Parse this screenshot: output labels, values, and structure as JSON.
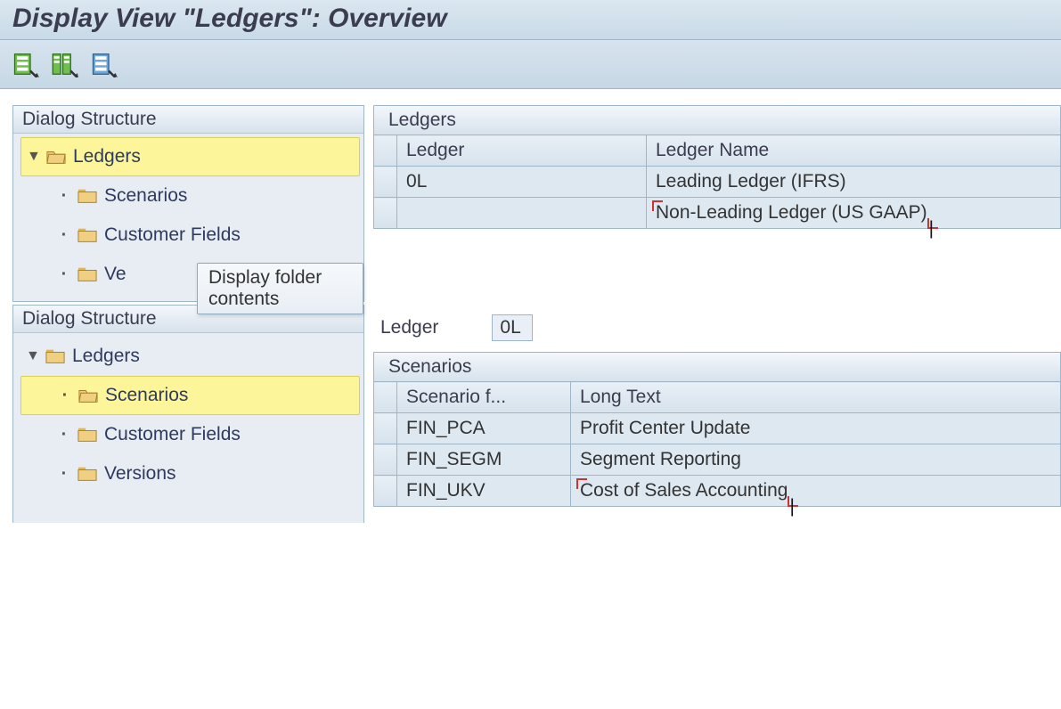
{
  "title": "Display View \"Ledgers\": Overview",
  "toolbar": {
    "icons": [
      "table-green-icon",
      "table-double-green-icon",
      "table-blue-icon"
    ]
  },
  "tree_header": "Dialog Structure",
  "tree1": {
    "root": "Ledgers",
    "children": [
      "Scenarios",
      "Customer Fields",
      "Ve"
    ],
    "selected": "Ledgers"
  },
  "tree2": {
    "root": "Ledgers",
    "children": [
      "Scenarios",
      "Customer Fields",
      "Versions"
    ],
    "selected": "Scenarios"
  },
  "tooltip": "Display folder contents",
  "ledgers_table": {
    "title": "Ledgers",
    "columns": [
      "Ledger",
      "Ledger Name"
    ],
    "rows": [
      {
        "ledger": "0L",
        "name": "Leading Ledger (IFRS)"
      },
      {
        "ledger": "",
        "name": "Non-Leading Ledger (US GAAP)"
      }
    ]
  },
  "ledger_field": {
    "label": "Ledger",
    "value": "0L"
  },
  "scenarios_table": {
    "title": "Scenarios",
    "columns": [
      "Scenario f...",
      "Long Text"
    ],
    "rows": [
      {
        "scn": "FIN_PCA",
        "txt": "Profit Center Update"
      },
      {
        "scn": "FIN_SEGM",
        "txt": "Segment Reporting"
      },
      {
        "scn": "FIN_UKV",
        "txt": "Cost of Sales Accounting"
      }
    ]
  }
}
